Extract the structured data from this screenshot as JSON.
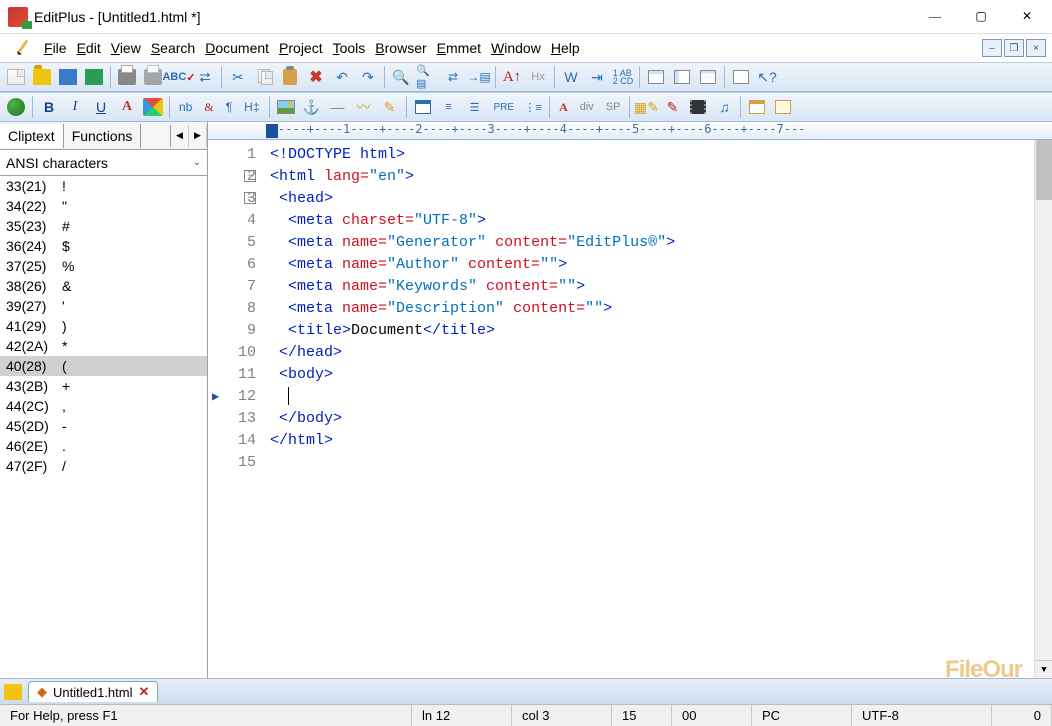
{
  "window": {
    "title": "EditPlus - [Untitled1.html *]"
  },
  "menu": {
    "items": [
      {
        "label": "File",
        "u": "F"
      },
      {
        "label": "Edit",
        "u": "E"
      },
      {
        "label": "View",
        "u": "V"
      },
      {
        "label": "Search",
        "u": "S"
      },
      {
        "label": "Document",
        "u": "D"
      },
      {
        "label": "Project",
        "u": "P"
      },
      {
        "label": "Tools",
        "u": "T"
      },
      {
        "label": "Browser",
        "u": "B"
      },
      {
        "label": "Emmet",
        "u": "E"
      },
      {
        "label": "Window",
        "u": "W"
      },
      {
        "label": "Help",
        "u": "H"
      }
    ]
  },
  "sidebar": {
    "tabs": {
      "cliptext": "Cliptext",
      "functions": "Functions"
    },
    "combo": "ANSI characters",
    "chars": [
      {
        "code": "33(21)",
        "val": "!"
      },
      {
        "code": "34(22)",
        "val": "\""
      },
      {
        "code": "35(23)",
        "val": "#"
      },
      {
        "code": "36(24)",
        "val": "$"
      },
      {
        "code": "37(25)",
        "val": "%"
      },
      {
        "code": "38(26)",
        "val": "&"
      },
      {
        "code": "39(27)",
        "val": "'"
      },
      {
        "code": "41(29)",
        "val": ")"
      },
      {
        "code": "42(2A)",
        "val": "*"
      },
      {
        "code": "40(28)",
        "val": "(",
        "sel": true
      },
      {
        "code": "43(2B)",
        "val": "+"
      },
      {
        "code": "44(2C)",
        "val": ","
      },
      {
        "code": "45(2D)",
        "val": "-"
      },
      {
        "code": "46(2E)",
        "val": "."
      },
      {
        "code": "47(2F)",
        "val": "/"
      }
    ]
  },
  "editor": {
    "ruler_scale": "----+----1----+----2----+----3----+----4----+----5----+----6----+----7---",
    "lines": [
      [
        {
          "c": "t-tag",
          "t": "<!DOCTYPE html>"
        }
      ],
      [
        {
          "c": "t-tag",
          "t": "<html "
        },
        {
          "c": "t-attr",
          "t": "lang="
        },
        {
          "c": "t-str",
          "t": "\"en\""
        },
        {
          "c": "t-tag",
          "t": ">"
        }
      ],
      [
        {
          "c": "t-tag",
          "t": " <head>"
        }
      ],
      [
        {
          "c": "t-tag",
          "t": "  <meta "
        },
        {
          "c": "t-attr",
          "t": "charset="
        },
        {
          "c": "t-str",
          "t": "\"UTF-8\""
        },
        {
          "c": "t-tag",
          "t": ">"
        }
      ],
      [
        {
          "c": "t-tag",
          "t": "  <meta "
        },
        {
          "c": "t-attr",
          "t": "name="
        },
        {
          "c": "t-str",
          "t": "\"Generator\""
        },
        {
          "c": "t-attr",
          "t": " content="
        },
        {
          "c": "t-str",
          "t": "\"EditPlus®\""
        },
        {
          "c": "t-tag",
          "t": ">"
        }
      ],
      [
        {
          "c": "t-tag",
          "t": "  <meta "
        },
        {
          "c": "t-attr",
          "t": "name="
        },
        {
          "c": "t-str",
          "t": "\"Author\""
        },
        {
          "c": "t-attr",
          "t": " content="
        },
        {
          "c": "t-str",
          "t": "\"\""
        },
        {
          "c": "t-tag",
          "t": ">"
        }
      ],
      [
        {
          "c": "t-tag",
          "t": "  <meta "
        },
        {
          "c": "t-attr",
          "t": "name="
        },
        {
          "c": "t-str",
          "t": "\"Keywords\""
        },
        {
          "c": "t-attr",
          "t": " content="
        },
        {
          "c": "t-str",
          "t": "\"\""
        },
        {
          "c": "t-tag",
          "t": ">"
        }
      ],
      [
        {
          "c": "t-tag",
          "t": "  <meta "
        },
        {
          "c": "t-attr",
          "t": "name="
        },
        {
          "c": "t-str",
          "t": "\"Description\""
        },
        {
          "c": "t-attr",
          "t": " content="
        },
        {
          "c": "t-str",
          "t": "\"\""
        },
        {
          "c": "t-tag",
          "t": ">"
        }
      ],
      [
        {
          "c": "t-tag",
          "t": "  <title>"
        },
        {
          "c": "t-text",
          "t": "Document"
        },
        {
          "c": "t-tag",
          "t": "</title>"
        }
      ],
      [
        {
          "c": "t-tag",
          "t": " </head>"
        }
      ],
      [
        {
          "c": "t-tag",
          "t": " <body>"
        }
      ],
      [
        {
          "c": "t-text",
          "t": "  "
        }
      ],
      [
        {
          "c": "t-tag",
          "t": " </body>"
        }
      ],
      [
        {
          "c": "t-tag",
          "t": "</html>"
        }
      ],
      [
        {
          "c": "t-text",
          "t": ""
        }
      ]
    ],
    "current_line_index": 11
  },
  "doctabs": {
    "name": "Untitled1.html"
  },
  "status": {
    "help": "For Help, press F1",
    "line": "ln 12",
    "col": "col 3",
    "v1": "15",
    "v2": "00",
    "lineend": "PC",
    "encoding": "UTF-8",
    "last": "0"
  },
  "toolbar2": {
    "nb": "nb",
    "amp": "&",
    "para": "¶",
    "hh": "H‡",
    "pre": "PRE",
    "aig": "A",
    "div": "div",
    "sp": "SP"
  },
  "watermark": "FileOur"
}
